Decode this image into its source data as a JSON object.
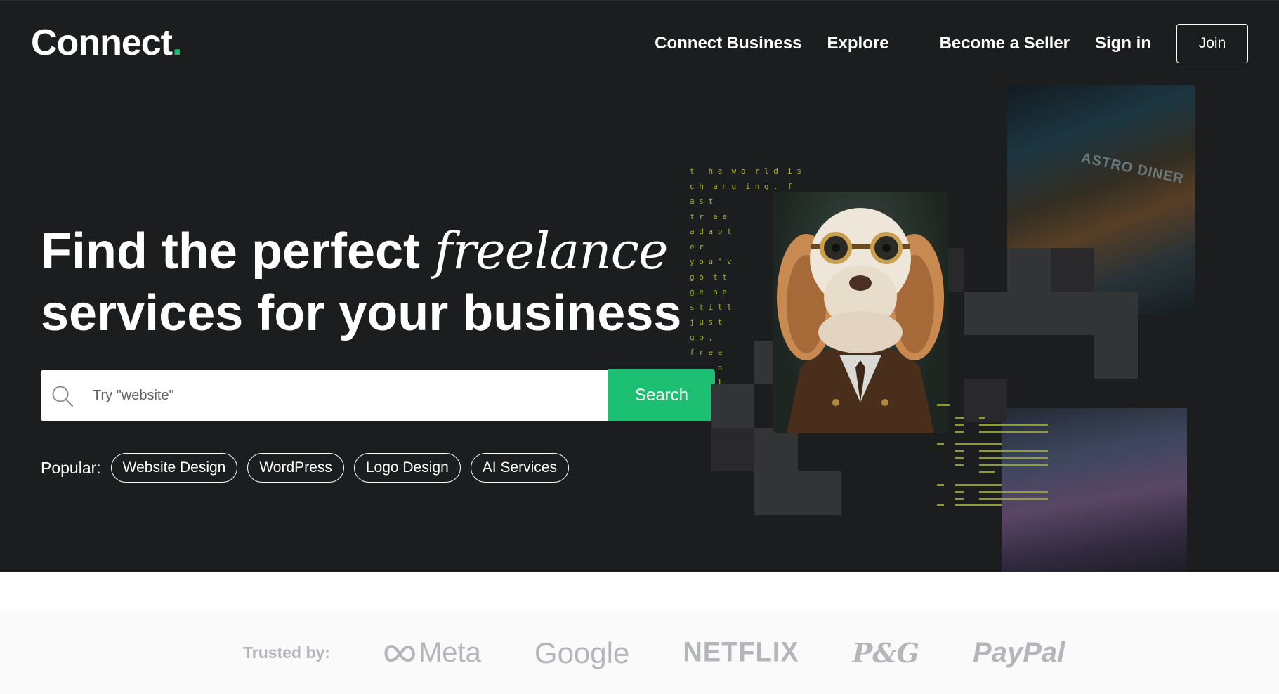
{
  "header": {
    "logo_text": "Connect",
    "logo_dot": ".",
    "nav": {
      "connect_business": "Connect Business",
      "explore": "Explore",
      "become_seller": "Become a Seller",
      "sign_in": "Sign in",
      "join": "Join"
    }
  },
  "hero": {
    "headline_line1_start": "Find the perfect ",
    "headline_line1_italic": "freelance",
    "headline_line2": "services for your business",
    "search": {
      "placeholder": "Try \"website\"",
      "button_label": "Search"
    },
    "popular": {
      "label": "Popular:",
      "tags": [
        "Website Design",
        "WordPress",
        "Logo Design",
        "AI Services"
      ]
    },
    "matrix_text": "t   h e  w o  r l d  i s\nc h  a n g  i n g .  f\na s t\nf r  e e\na d a p t\ne r\ny o u ' v\ng o  t t\ng e  n e\ns t i l l\nj u s t\ng o ,\nf r e e\n      n\n      l",
    "photo_top_label": "ASTRO DINER"
  },
  "trusted": {
    "label": "Trusted by:",
    "brands": {
      "meta": "Meta",
      "google": "Google",
      "netflix": "NETFLIX",
      "pg": "P&G",
      "paypal": "PayPal"
    }
  },
  "colors": {
    "accent": "#1dbf73",
    "hero_bg": "#1c1d1f",
    "trusted_bg": "#fafafa",
    "brand_gray": "#b5b6ba"
  }
}
